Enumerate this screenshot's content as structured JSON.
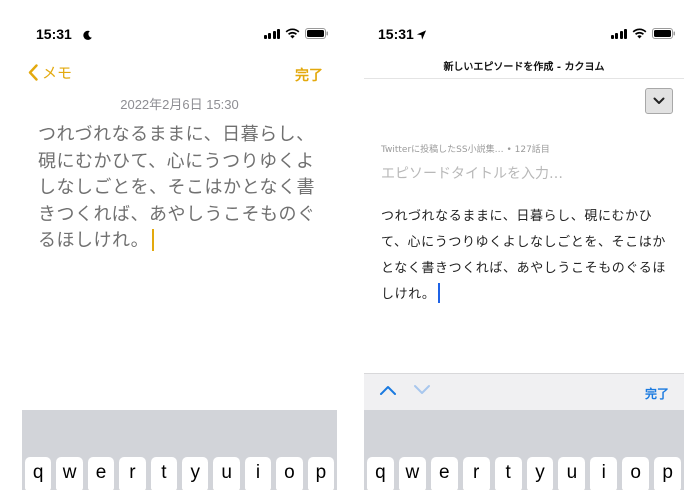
{
  "colors": {
    "notes_accent": "#e3a90d",
    "web_accent": "#1a7ae0",
    "keyboard_bg": "#d2d4d9"
  },
  "left": {
    "status": {
      "time": "15:31",
      "focus_icon": "moon-icon"
    },
    "nav": {
      "back_label": "メモ",
      "done_label": "完了"
    },
    "note": {
      "date": "2022年2月6日 15:30",
      "body": "つれづれなるままに、日暮らし、硯にむかひて、心にうつりゆくよしなしごとを、そこはかとなく書きつくれば、あやしうこそものぐるほしけれ。"
    },
    "keyboard": {
      "keys": [
        "q",
        "w",
        "e",
        "r",
        "t",
        "y",
        "u",
        "i",
        "o",
        "p"
      ]
    }
  },
  "right": {
    "status": {
      "time": "15:31",
      "location_icon": "location-arrow-icon"
    },
    "page_title": "新しいエピソードを作成 - カクヨム",
    "episode": {
      "meta": "Twitterに投稿したSS小説集… • 127話目",
      "title_placeholder": "エピソードタイトルを入力…",
      "body": "つれづれなるままに、日暮らし、硯にむかひて、心にうつりゆくよしなしごとを、そこはかとなく書きつくれば、あやしうこそものぐるほしけれ。"
    },
    "accessory": {
      "done_label": "完了"
    },
    "keyboard": {
      "keys": [
        "q",
        "w",
        "e",
        "r",
        "t",
        "y",
        "u",
        "i",
        "o",
        "p"
      ]
    }
  }
}
